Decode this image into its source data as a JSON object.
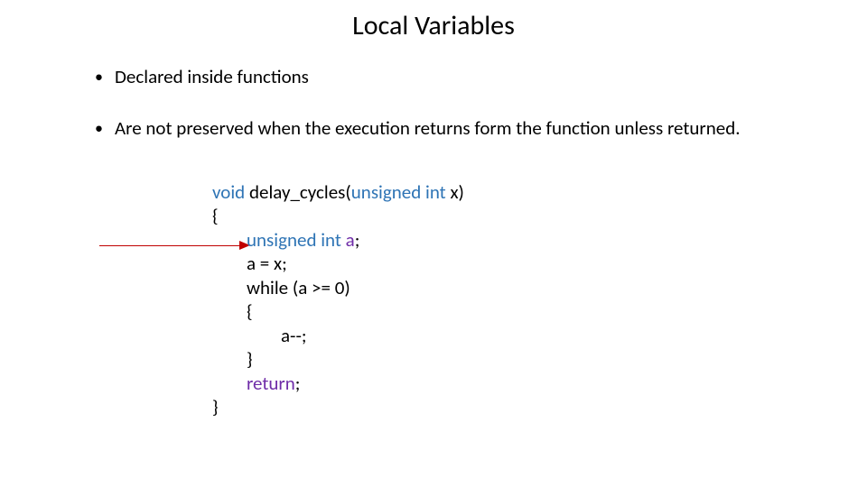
{
  "title": "Local Variables",
  "bullets": [
    "Declared inside functions",
    "Are not preserved when the execution returns form the function unless returned."
  ],
  "code": {
    "sig_void": "void",
    "sig_fn": "delay_cycles",
    "sig_open": "(",
    "sig_type": "unsigned int",
    "sig_param": " x)",
    "brace_open": "{",
    "decl_type": "unsigned int",
    "decl_var": " a",
    "decl_semi": ";",
    "assign": "a = x;",
    "while": "while (a >= 0)",
    "inner_open": "{",
    "decr": "a--;",
    "inner_close": "}",
    "ret_kw": "return",
    "ret_semi": ";",
    "brace_close": "}"
  }
}
